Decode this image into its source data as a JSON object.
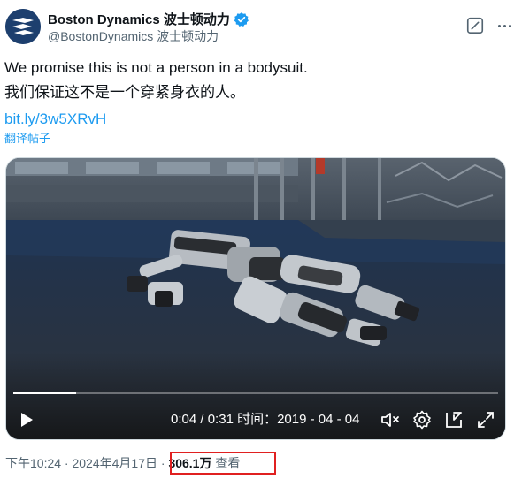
{
  "author": {
    "name": "Boston Dynamics 波士顿动力",
    "handle": "@BostonDynamics 波士顿动力"
  },
  "post": {
    "text_en": "We promise this is not a person in a bodysuit.",
    "text_zh": "我们保证这不是一个穿紧身衣的人。",
    "link": "bit.ly/3w5XRvH",
    "translate_label": "翻译帖子"
  },
  "video": {
    "current_time": "0:04",
    "duration": "0:31",
    "time_label": "时间：2019 - 04 - 04",
    "progress_fraction": 0.13,
    "icons": [
      "play-icon",
      "mute-icon",
      "settings-icon",
      "pip-icon",
      "fullscreen-icon"
    ]
  },
  "meta": {
    "timestamp": "下午10:24 · 2024年4月17日",
    "separator": " · ",
    "views_count": "306.1万",
    "views_label": "查看"
  },
  "colors": {
    "link": "#1d9bf0",
    "verified": "#1d9bf0",
    "highlight": "#e02020"
  }
}
